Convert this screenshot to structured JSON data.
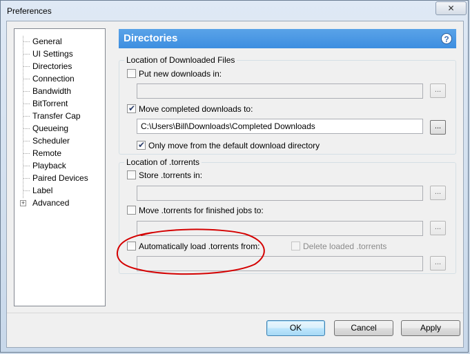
{
  "window": {
    "title": "Preferences",
    "close_glyph": "✕"
  },
  "tree": {
    "items": [
      {
        "label": "General"
      },
      {
        "label": "UI Settings"
      },
      {
        "label": "Directories"
      },
      {
        "label": "Connection"
      },
      {
        "label": "Bandwidth"
      },
      {
        "label": "BitTorrent"
      },
      {
        "label": "Transfer Cap"
      },
      {
        "label": "Queueing"
      },
      {
        "label": "Scheduler"
      },
      {
        "label": "Remote"
      },
      {
        "label": "Playback"
      },
      {
        "label": "Paired Devices"
      },
      {
        "label": "Label"
      },
      {
        "label": "Advanced"
      }
    ],
    "selected": "Directories",
    "expander_glyph": "+"
  },
  "header": {
    "title": "Directories",
    "help_glyph": "?"
  },
  "downloaded_files": {
    "group_label": "Location of Downloaded Files",
    "put_new": {
      "label": "Put new downloads in:",
      "checked": false,
      "path": ""
    },
    "move_completed": {
      "label": "Move completed downloads to:",
      "checked": true,
      "path": "C:\\Users\\Bill\\Downloads\\Completed Downloads"
    },
    "only_move_default": {
      "label": "Only move from the default download directory",
      "checked": true
    }
  },
  "torrents": {
    "group_label": "Location of .torrents",
    "store": {
      "label": "Store .torrents in:",
      "checked": false,
      "path": ""
    },
    "move_finished": {
      "label": "Move .torrents for finished jobs to:",
      "checked": false,
      "path": ""
    },
    "auto_load": {
      "label": "Automatically load .torrents from:",
      "checked": false,
      "path": ""
    },
    "delete_loaded": {
      "label": "Delete loaded .torrents",
      "checked": false,
      "disabled": true
    }
  },
  "browse_label": "...",
  "buttons": {
    "ok": "OK",
    "cancel": "Cancel",
    "apply": "Apply"
  },
  "colors": {
    "header_blue": "#3d8ee0",
    "annotation_red": "#d40000"
  }
}
